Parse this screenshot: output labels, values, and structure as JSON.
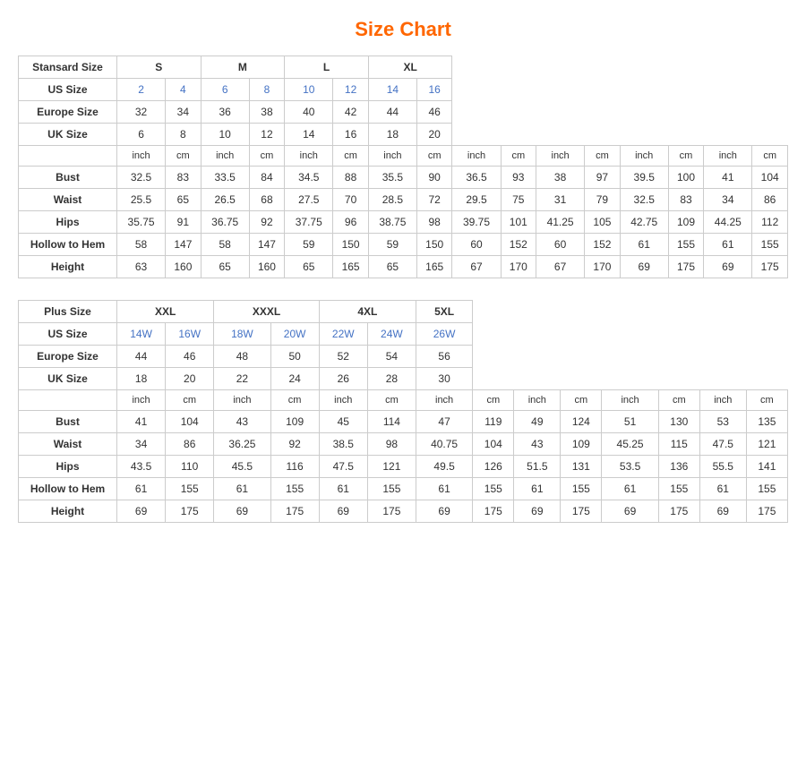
{
  "title": "Size Chart",
  "standard": {
    "label": "Stansard Size",
    "columns": [
      "S",
      "M",
      "L",
      "XL"
    ],
    "col_span": [
      2,
      2,
      2,
      2
    ],
    "us_sizes": [
      "2",
      "4",
      "6",
      "8",
      "10",
      "12",
      "14",
      "16"
    ],
    "europe_sizes": [
      "32",
      "34",
      "36",
      "38",
      "40",
      "42",
      "44",
      "46"
    ],
    "uk_sizes": [
      "6",
      "8",
      "10",
      "12",
      "14",
      "16",
      "18",
      "20"
    ],
    "sub_headers": [
      "inch",
      "cm",
      "inch",
      "cm",
      "inch",
      "cm",
      "inch",
      "cm",
      "inch",
      "cm",
      "inch",
      "cm",
      "inch",
      "cm",
      "inch",
      "cm"
    ],
    "measurements": {
      "Bust": [
        "32.5",
        "83",
        "33.5",
        "84",
        "34.5",
        "88",
        "35.5",
        "90",
        "36.5",
        "93",
        "38",
        "97",
        "39.5",
        "100",
        "41",
        "104"
      ],
      "Waist": [
        "25.5",
        "65",
        "26.5",
        "68",
        "27.5",
        "70",
        "28.5",
        "72",
        "29.5",
        "75",
        "31",
        "79",
        "32.5",
        "83",
        "34",
        "86"
      ],
      "Hips": [
        "35.75",
        "91",
        "36.75",
        "92",
        "37.75",
        "96",
        "38.75",
        "98",
        "39.75",
        "101",
        "41.25",
        "105",
        "42.75",
        "109",
        "44.25",
        "112"
      ],
      "Hollow to Hem": [
        "58",
        "147",
        "58",
        "147",
        "59",
        "150",
        "59",
        "150",
        "60",
        "152",
        "60",
        "152",
        "61",
        "155",
        "61",
        "155"
      ],
      "Height": [
        "63",
        "160",
        "65",
        "160",
        "65",
        "165",
        "65",
        "165",
        "67",
        "170",
        "67",
        "170",
        "69",
        "175",
        "69",
        "175"
      ]
    }
  },
  "plus": {
    "label": "Plus Size",
    "columns": [
      "XXL",
      "XXXL",
      "4XL",
      "5XL"
    ],
    "col_span": [
      2,
      2,
      2,
      1
    ],
    "us_sizes": [
      "14W",
      "16W",
      "18W",
      "20W",
      "22W",
      "24W",
      "26W"
    ],
    "europe_sizes": [
      "44",
      "46",
      "48",
      "50",
      "52",
      "54",
      "56"
    ],
    "uk_sizes": [
      "18",
      "20",
      "22",
      "24",
      "26",
      "28",
      "30"
    ],
    "sub_headers": [
      "inch",
      "cm",
      "inch",
      "cm",
      "inch",
      "cm",
      "inch",
      "cm",
      "inch",
      "cm",
      "inch",
      "cm",
      "inch",
      "cm"
    ],
    "measurements": {
      "Bust": [
        "41",
        "104",
        "43",
        "109",
        "45",
        "114",
        "47",
        "119",
        "49",
        "124",
        "51",
        "130",
        "53",
        "135"
      ],
      "Waist": [
        "34",
        "86",
        "36.25",
        "92",
        "38.5",
        "98",
        "40.75",
        "104",
        "43",
        "109",
        "45.25",
        "115",
        "47.5",
        "121"
      ],
      "Hips": [
        "43.5",
        "110",
        "45.5",
        "116",
        "47.5",
        "121",
        "49.5",
        "126",
        "51.5",
        "131",
        "53.5",
        "136",
        "55.5",
        "141"
      ],
      "Hollow to Hem": [
        "61",
        "155",
        "61",
        "155",
        "61",
        "155",
        "61",
        "155",
        "61",
        "155",
        "61",
        "155",
        "61",
        "155"
      ],
      "Height": [
        "69",
        "175",
        "69",
        "175",
        "69",
        "175",
        "69",
        "175",
        "69",
        "175",
        "69",
        "175",
        "69",
        "175"
      ]
    }
  }
}
